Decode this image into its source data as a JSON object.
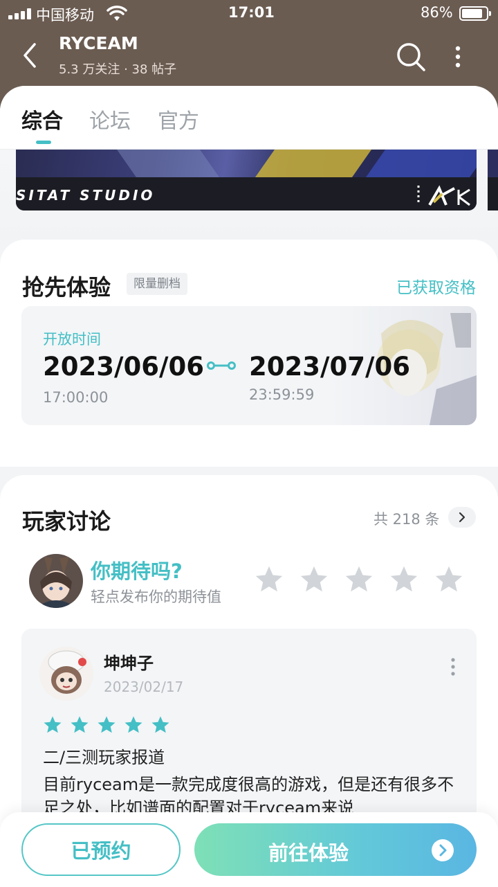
{
  "status_bar": {
    "carrier": "中国移动",
    "time": "17:01",
    "battery": "86%"
  },
  "header": {
    "title": "RYCEAM",
    "stats": "5.3 万关注 · 38 帖子"
  },
  "tabs": [
    {
      "label": "综合",
      "active": true
    },
    {
      "label": "论坛",
      "active": false
    },
    {
      "label": "官方",
      "active": false
    }
  ],
  "banner": {
    "caption": "SITAT  STUDIO"
  },
  "early_access": {
    "title": "抢先体验",
    "tag": "限量删档",
    "status": "已获取资格",
    "open_label": "开放时间",
    "start_date": "2023/06/06",
    "start_time": "17:00:00",
    "end_date": "2023/07/06",
    "end_time": "23:59:59"
  },
  "discussion": {
    "title": "玩家讨论",
    "count": "共 218 条",
    "prompt": "你期待吗?",
    "prompt_hint": "轻点发布你的期待值",
    "rating_stars": 5,
    "review": {
      "author": "坤坤子",
      "date": "2023/02/17",
      "rating": 5,
      "title": "二/三测玩家报道",
      "body": "目前ryceam是一款完成度很高的游戏，但是还有很多不足之处，比如谱面的配置对于ryceam来说"
    }
  },
  "bottom": {
    "reserved_label": "已预约",
    "go_label": "前往体验"
  },
  "colors": {
    "accent": "#44bfc5",
    "header_bg": "#6b5c52",
    "star_inactive": "#d1d5d9"
  }
}
